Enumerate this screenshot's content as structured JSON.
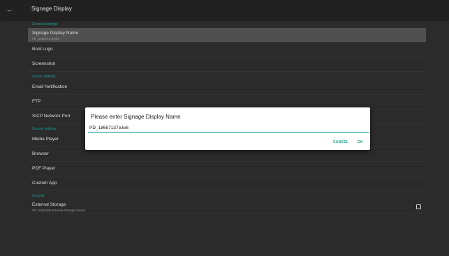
{
  "header": {
    "back_icon": "arrow-left-icon",
    "title": "Signage Display"
  },
  "sections": {
    "general": "General settings",
    "server": "Server settings",
    "source": "Source settings",
    "security": "Security"
  },
  "items": {
    "signage_display_name": {
      "label": "Signage Display Name",
      "sub": "PD_18657137e3e6"
    },
    "boot_logo": "Boot Logo",
    "screenshot": "Screenshot",
    "email_notification": "Email Notification",
    "ftp": "FTP",
    "sicp_network_port": "SICP Network Port",
    "media_player": "Media Player",
    "browser": "Browser",
    "pdf_player": "PDF Player",
    "custom_app": "Custom App",
    "external_storage": {
      "label": "External Storage",
      "sub": "SD card/USB External Storage Unlock",
      "checked": false
    }
  },
  "dialog": {
    "title": "Please enter Signage Display Name",
    "value": "PD_18657137e3e6",
    "cancel": "CANCEL",
    "ok": "OK"
  },
  "colors": {
    "accent": "#1e9e8f",
    "background": "#2b2b2b",
    "topbar": "#212121",
    "selected_row": "#505050"
  }
}
